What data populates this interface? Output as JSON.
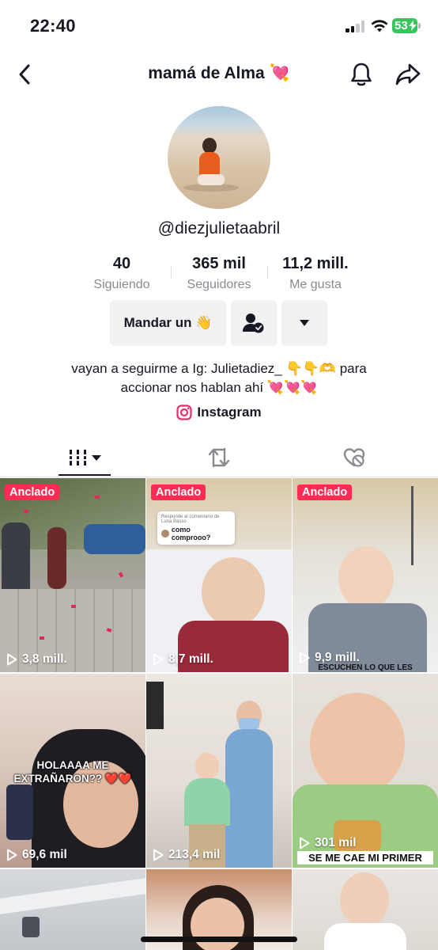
{
  "status_bar": {
    "time": "22:40",
    "battery": "53"
  },
  "header": {
    "title": "mamá de Alma 💘"
  },
  "profile": {
    "username": "@diezjulietaabril",
    "stats": [
      {
        "value": "40",
        "label": "Siguiendo"
      },
      {
        "value": "365 mil",
        "label": "Seguidores"
      },
      {
        "value": "11,2 mill.",
        "label": "Me gusta"
      }
    ],
    "message_button": "Mandar un 👋",
    "bio_line1": "vayan a seguirme a Ig: Julietadiez_ 👇👇🫶 para",
    "bio_line2": "accionar nos hablan ahí 💘💘💘",
    "instagram_label": "Instagram"
  },
  "videos": [
    {
      "pinned": "Anclado",
      "views": "3,8 mill."
    },
    {
      "pinned": "Anclado",
      "views": "8,7 mill.",
      "comment_header": "Responde al comentario de Luna Basso",
      "comment_text": "como comprooo?"
    },
    {
      "pinned": "Anclado",
      "views": "9,9 mill.",
      "overlay": "ESCUCHEN LO QUE LES"
    },
    {
      "views": "69,6 mil",
      "overlay": "HOLAAAA ME EXTRAÑARON?? ❤️❤️"
    },
    {
      "views": "213,4 mil"
    },
    {
      "views": "301 mil",
      "overlay": "SE ME CAE MI PRIMER"
    },
    {},
    {},
    {}
  ],
  "colors": {
    "accent": "#fe2c55",
    "text": "#161823",
    "muted": "#8a8b91",
    "button_bg": "#f1f1f2"
  }
}
